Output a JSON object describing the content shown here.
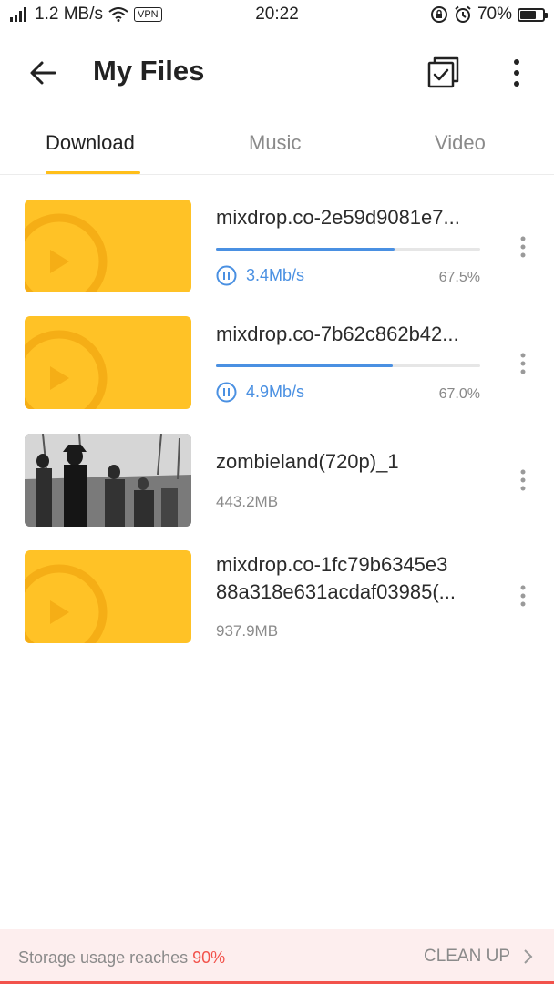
{
  "status_bar": {
    "network_speed": "1.2 MB/s",
    "vpn": "VPN",
    "time": "20:22",
    "battery": "70%",
    "battery_level": 0.7
  },
  "header": {
    "title": "My Files"
  },
  "tabs": [
    {
      "label": "Download",
      "active": true
    },
    {
      "label": "Music",
      "active": false
    },
    {
      "label": "Video",
      "active": false
    }
  ],
  "files": [
    {
      "name": "mixdrop.co-2e59d9081e7...",
      "speed": "3.4Mb/s",
      "percent": "67.5%",
      "progress": 0.675,
      "thumbnail": "video-placeholder"
    },
    {
      "name": "mixdrop.co-7b62c862b42...",
      "speed": "4.9Mb/s",
      "percent": "67.0%",
      "progress": 0.67,
      "thumbnail": "video-placeholder"
    },
    {
      "name": "zombieland(720p)_1",
      "size": "443.2MB",
      "thumbnail": "video-frame"
    },
    {
      "name_line1": "mixdrop.co-1fc79b6345e3",
      "name_line2": "88a318e631acdaf03985(...",
      "size": "937.9MB",
      "thumbnail": "video-placeholder"
    }
  ],
  "footer": {
    "storage_text": "Storage usage reaches ",
    "storage_percent": "90%",
    "cleanup_label": "CLEAN UP"
  },
  "colors": {
    "accent_yellow": "#ffc226",
    "progress_blue": "#4a90e2",
    "warning_red": "#f2524b"
  }
}
